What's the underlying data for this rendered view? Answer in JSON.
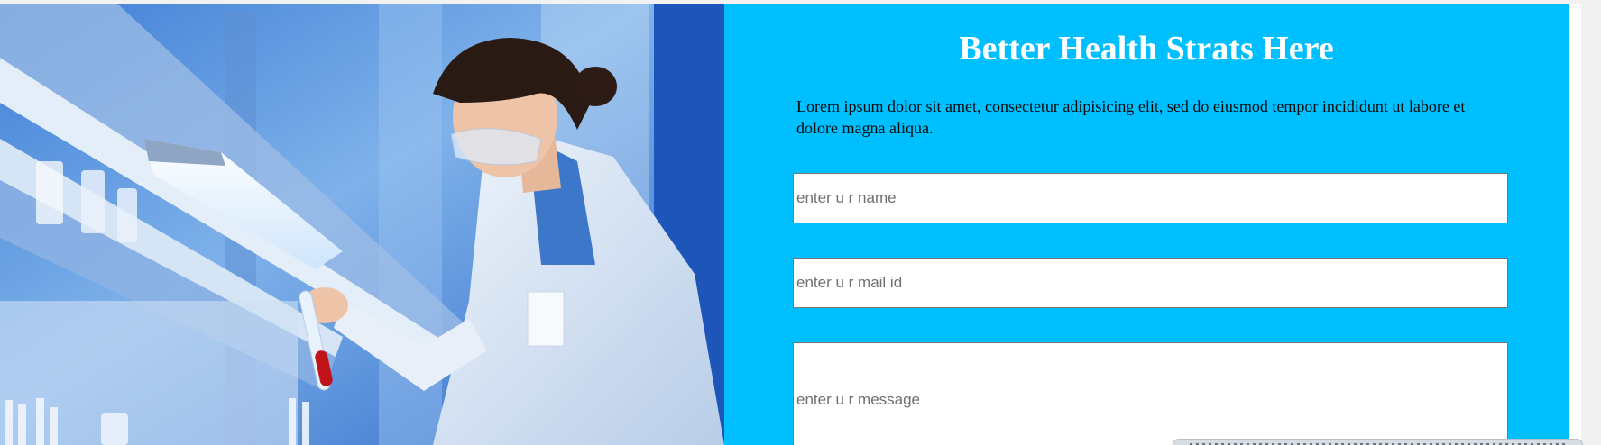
{
  "hero": {
    "image_label": "scientist-with-test-tube-photo"
  },
  "form": {
    "title": "Better Health Strats Here",
    "intro": "Lorem ipsum dolor sit amet, consectetur adipisicing elit, sed do eiusmod tempor incididunt ut labore et dolore magna aliqua.",
    "name_placeholder": "enter u r name",
    "mail_placeholder": "enter u r mail id",
    "message_placeholder": "enter u r message"
  },
  "colors": {
    "panel_background": "#00bfff",
    "title_color": "#ffffff",
    "text_color": "#0a0a0a"
  }
}
